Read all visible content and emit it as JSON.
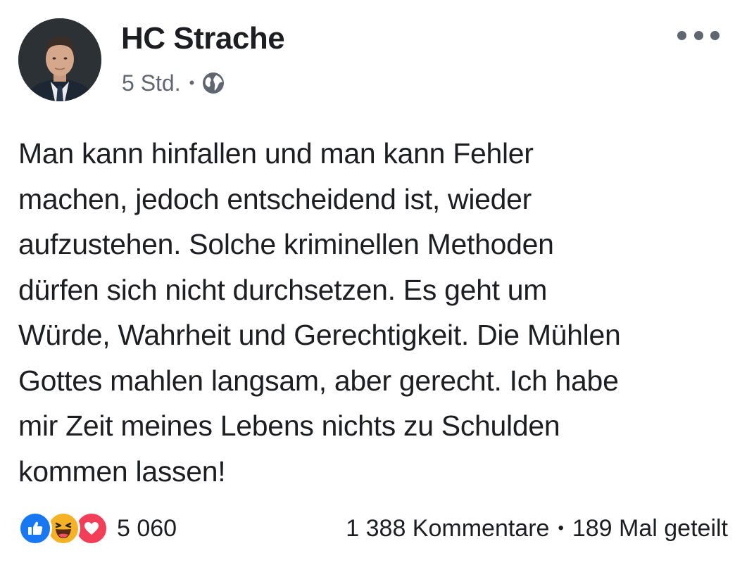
{
  "post": {
    "author": "HC Strache",
    "time": "5 Std.",
    "separator": "•",
    "privacy_icon": "globe-icon",
    "more_icon": "more-horizontal-icon",
    "text_lines": [
      "Man kann hinfallen und man kann Fehler",
      "machen, jedoch entscheidend ist, wieder",
      "aufzustehen. Solche kriminellen Methoden",
      "dürfen sich nicht durchsetzen. Es geht um",
      "Würde, Wahrheit und Gerechtigkeit. Die Mühlen",
      "Gottes mahlen langsam, aber gerecht. Ich habe",
      "mir Zeit meines Lebens nichts zu Schulden",
      "kommen lassen!"
    ]
  },
  "footer": {
    "reaction_icons": [
      "like-icon",
      "haha-icon",
      "love-icon"
    ],
    "reaction_count": "5 060",
    "comments": "1 388 Kommentare",
    "separator": "•",
    "shares": "189 Mal geteilt"
  },
  "colors": {
    "text": "#1c1e21",
    "secondary": "#606770",
    "like": "#1877f2",
    "haha": "#f7b125",
    "love": "#f33e58"
  }
}
